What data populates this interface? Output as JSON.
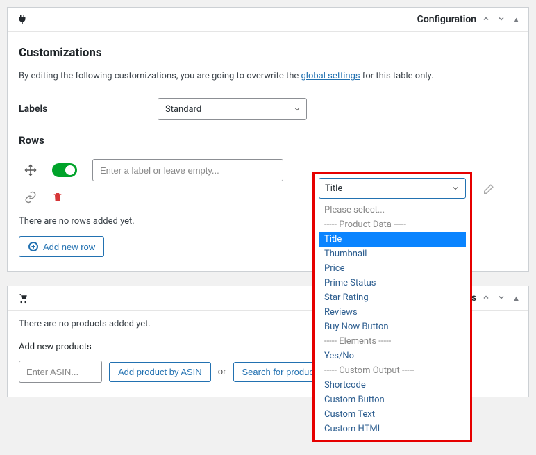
{
  "config_panel": {
    "title": "Configuration"
  },
  "customizations": {
    "heading": "Customizations",
    "helptext_before": "By editing the following customizations, you are going to overwrite the ",
    "helptext_link": "global settings",
    "helptext_after": " for this table only."
  },
  "labels_field": {
    "label": "Labels",
    "value": "Standard"
  },
  "rows_section": {
    "heading": "Rows",
    "input_placeholder": "Enter a label or leave empty...",
    "input_value": "",
    "empty_state": "There are no rows added yet.",
    "add_button": "Add new row"
  },
  "dropdown": {
    "selected": "Title",
    "options": [
      {
        "label": "Please select...",
        "kind": "placeholder"
      },
      {
        "label": "----- Product Data -----",
        "kind": "group"
      },
      {
        "label": "Title",
        "kind": "option",
        "selected": true
      },
      {
        "label": "Thumbnail",
        "kind": "option"
      },
      {
        "label": "Price",
        "kind": "option"
      },
      {
        "label": "Prime Status",
        "kind": "option"
      },
      {
        "label": "Star Rating",
        "kind": "option"
      },
      {
        "label": "Reviews",
        "kind": "option"
      },
      {
        "label": "Buy Now Button",
        "kind": "option"
      },
      {
        "label": "----- Elements -----",
        "kind": "group"
      },
      {
        "label": "Yes/No",
        "kind": "option"
      },
      {
        "label": "----- Custom Output -----",
        "kind": "group"
      },
      {
        "label": "Shortcode",
        "kind": "option"
      },
      {
        "label": "Custom Button",
        "kind": "option"
      },
      {
        "label": "Custom Text",
        "kind": "option"
      },
      {
        "label": "Custom HTML",
        "kind": "option"
      }
    ]
  },
  "products_panel": {
    "title_suffix": "ts",
    "empty_state": "There are no products added yet.",
    "add_heading": "Add new products",
    "asin_placeholder": "Enter ASIN...",
    "add_by_asin_btn": "Add product by ASIN",
    "or_sep": "or",
    "search_btn": "Search for product(s)"
  }
}
